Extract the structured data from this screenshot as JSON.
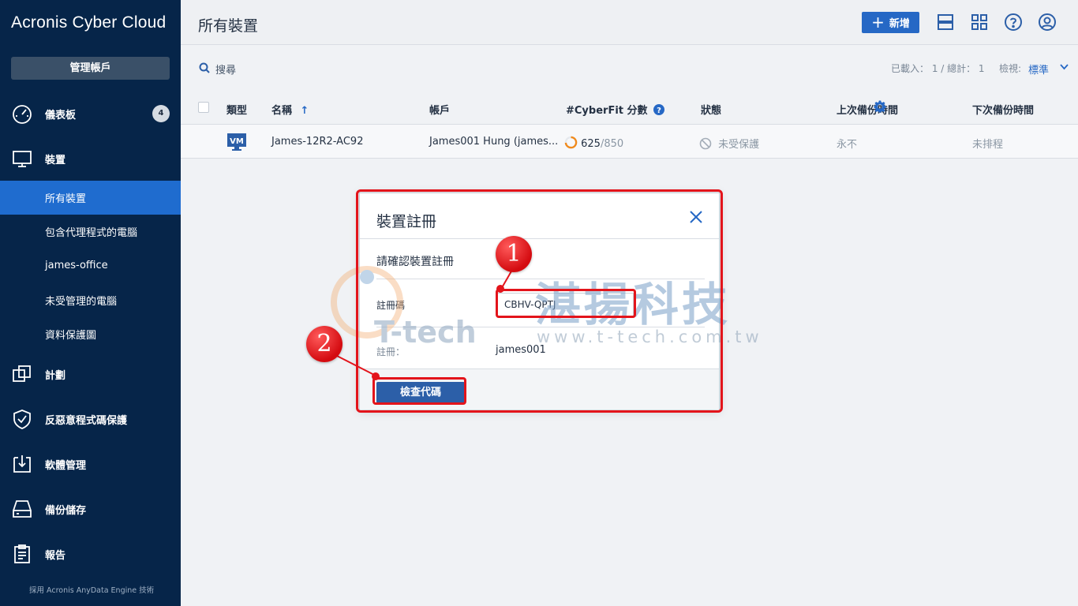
{
  "sidebar": {
    "brand": "Acronis Cyber Cloud",
    "manage_button": "管理帳戶",
    "dashboard": {
      "label": "儀表板",
      "badge": "4"
    },
    "devices": {
      "label": "裝置"
    },
    "sub_items": [
      "所有裝置",
      "包含代理程式的電腦",
      "james-office",
      "未受管理的電腦",
      "資料保護圖"
    ],
    "items": [
      {
        "label": "計劃"
      },
      {
        "label": "反惡意程式碼保護"
      },
      {
        "label": "軟體管理"
      },
      {
        "label": "備份儲存"
      },
      {
        "label": "報告"
      }
    ],
    "footer": "採用 Acronis AnyData Engine 技術"
  },
  "header": {
    "title": "所有裝置",
    "add_label": "新增"
  },
  "toolbar": {
    "search_label": "搜尋",
    "load_info": "已載入： 1 / 總計： 1",
    "view_label": "檢視:",
    "view_value": "標準"
  },
  "table": {
    "columns": [
      "類型",
      "名稱",
      "帳戶",
      "#CyberFit 分數",
      "狀態",
      "上次備份時間",
      "下次備份時間"
    ],
    "rows": [
      {
        "type": "VM",
        "name": "James-12R2-AC92",
        "account": "James001 Hung (james...",
        "score": "625",
        "score_max": "/850",
        "status": "未受保護",
        "last_backup": "永不",
        "next_backup": "未排程"
      }
    ]
  },
  "dialog": {
    "title": "裝置註冊",
    "confirm_text": "請確認裝置註冊",
    "code_label": "註冊碼",
    "code_value": "CBHV-QPTJ",
    "register_label": "註冊：",
    "register_value": "james001",
    "check_button": "檢查代碼"
  },
  "annotations": {
    "step1": "1",
    "step2": "2"
  },
  "watermark": {
    "chinese": "湛揚科技",
    "brand": "T-tech",
    "url": "www.t-tech.com.tw"
  },
  "colors": {
    "sidebar_bg": "#062549",
    "accent": "#2668c5",
    "active_nav": "#1f6ccf",
    "annotation_red": "#e3141b"
  }
}
